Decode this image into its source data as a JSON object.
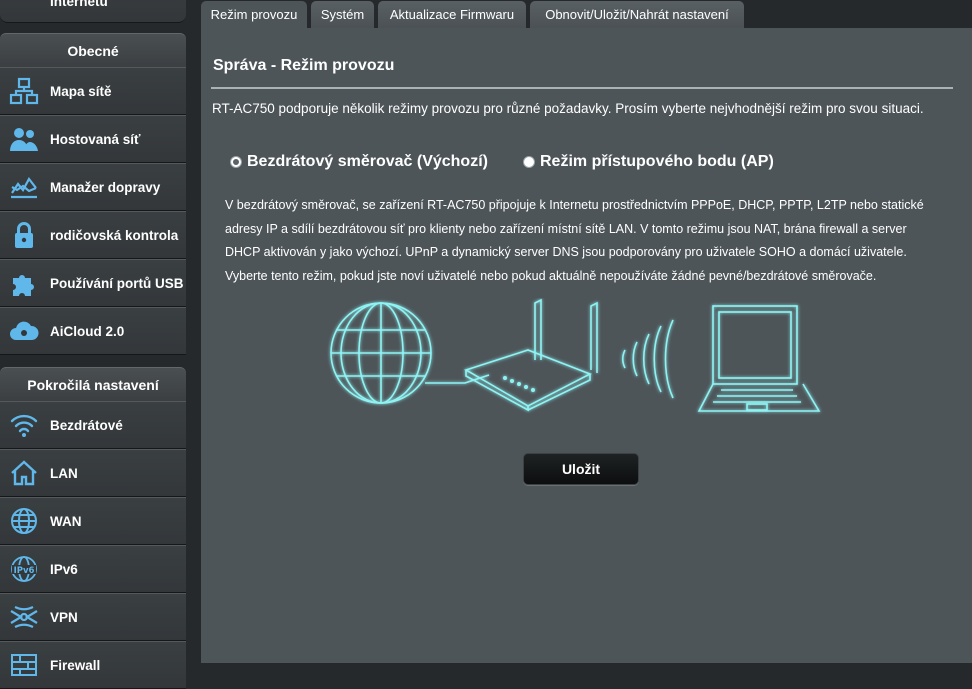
{
  "sidebar": {
    "top_cut_label": "Internetu",
    "general_header": "Obecné",
    "general_items": [
      {
        "label": "Mapa sítě",
        "icon": "network-map-icon"
      },
      {
        "label": "Hostovaná síť",
        "icon": "guest-network-icon"
      },
      {
        "label": "Manažer dopravy",
        "icon": "traffic-manager-icon"
      },
      {
        "label": "rodičovská kontrola",
        "icon": "lock-icon"
      },
      {
        "label": "Používání portů USB",
        "icon": "puzzle-icon"
      },
      {
        "label": "AiCloud 2.0",
        "icon": "cloud-icon"
      }
    ],
    "advanced_header": "Pokročilá nastavení",
    "advanced_items": [
      {
        "label": "Bezdrátové",
        "icon": "wifi-icon"
      },
      {
        "label": "LAN",
        "icon": "home-icon"
      },
      {
        "label": "WAN",
        "icon": "globe-icon"
      },
      {
        "label": "IPv6",
        "icon": "ipv6-icon"
      },
      {
        "label": "VPN",
        "icon": "vpn-icon"
      },
      {
        "label": "Firewall",
        "icon": "firewall-icon"
      }
    ]
  },
  "tabs": [
    {
      "label": "Režim provozu",
      "active": true
    },
    {
      "label": "Systém",
      "active": false
    },
    {
      "label": "Aktualizace Firmwaru",
      "active": false
    },
    {
      "label": "Obnovit/Uložit/Nahrát nastavení",
      "active": false
    }
  ],
  "main": {
    "title": "Správa - Režim provozu",
    "description": "RT-AC750 podporuje několik režimy provozu pro různé požadavky. Prosím vyberte nejvhodnější režim pro svou situaci.",
    "modes": [
      {
        "label": "Bezdrátový směrovač (Výchozí)",
        "selected": true
      },
      {
        "label": "Režim přístupového bodu (AP)",
        "selected": false
      }
    ],
    "mode_description": "V bezdrátový směrovač, se zařízení RT-AC750 připojuje k Internetu prostřednictvím PPPoE, DHCP, PPTP, L2TP nebo statické adresy IP a sdílí bezdrátovou síť pro klienty nebo zařízení místní sítě LAN. V tomto režimu jsou NAT, brána firewall a server DHCP aktivován y jako výchozí. UPnP a dynamický server DNS jsou podporovány pro uživatele SOHO a domácí uživatele. Vyberte tento režim, pokud jste noví uživatelé nebo pokud aktuálně nepoužíváte žádné pevné/bezdrátové směrovače.",
    "save_label": "Uložit"
  },
  "colors": {
    "panel_bg": "#4d5559",
    "sidebar_bg": "#26292b",
    "illustration_glow": "#8ff3f3"
  }
}
